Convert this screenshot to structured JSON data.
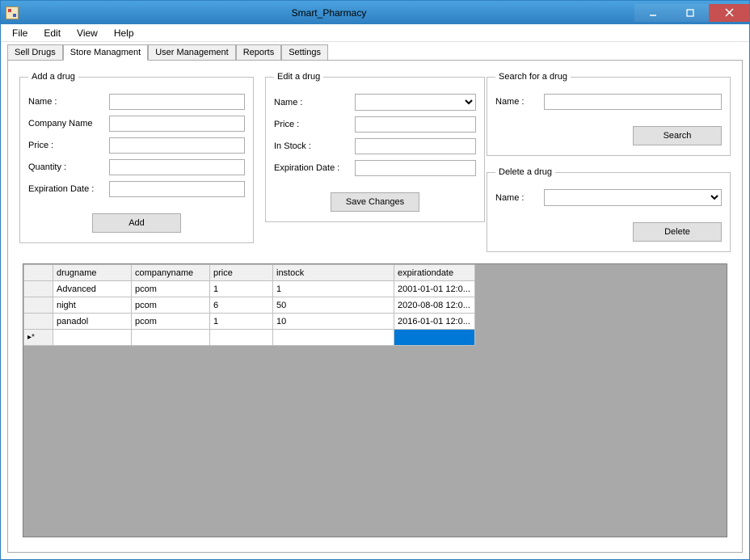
{
  "window": {
    "title": "Smart_Pharmacy"
  },
  "menu": {
    "file": "File",
    "edit": "Edit",
    "view": "View",
    "help": "Help"
  },
  "tabs": {
    "sell": "Sell Drugs",
    "store": "Store Managment",
    "user": "User Management",
    "reports": "Reports",
    "settings": "Settings"
  },
  "add_group": {
    "legend": "Add a drug",
    "name_label": "Name :",
    "company_label": "Company Name",
    "price_label": "Price :",
    "qty_label": "Quantity :",
    "exp_label": "Expiration Date :",
    "add_btn": "Add"
  },
  "edit_group": {
    "legend": "Edit a drug",
    "name_label": "Name :",
    "price_label": "Price :",
    "stock_label": "In Stock :",
    "exp_label": "Expiration Date :",
    "save_btn": "Save Changes"
  },
  "search_group": {
    "legend": "Search for a drug",
    "name_label": "Name :",
    "search_btn": "Search"
  },
  "delete_group": {
    "legend": "Delete a drug",
    "name_label": "Name :",
    "delete_btn": "Delete"
  },
  "grid": {
    "headers": {
      "drug": "drugname",
      "company": "companyname",
      "price": "price",
      "stock": "instock",
      "exp": "expirationdate"
    },
    "rows": [
      {
        "drug": "Advanced",
        "company": "pcom",
        "price": "1",
        "stock": "1",
        "exp": "2001-01-01 12:0..."
      },
      {
        "drug": "night",
        "company": "pcom",
        "price": "6",
        "stock": "50",
        "exp": "2020-08-08 12:0..."
      },
      {
        "drug": "panadol",
        "company": "pcom",
        "price": "1",
        "stock": "10",
        "exp": "2016-01-01 12:0..."
      }
    ],
    "newrow_indicator": "▸*"
  }
}
